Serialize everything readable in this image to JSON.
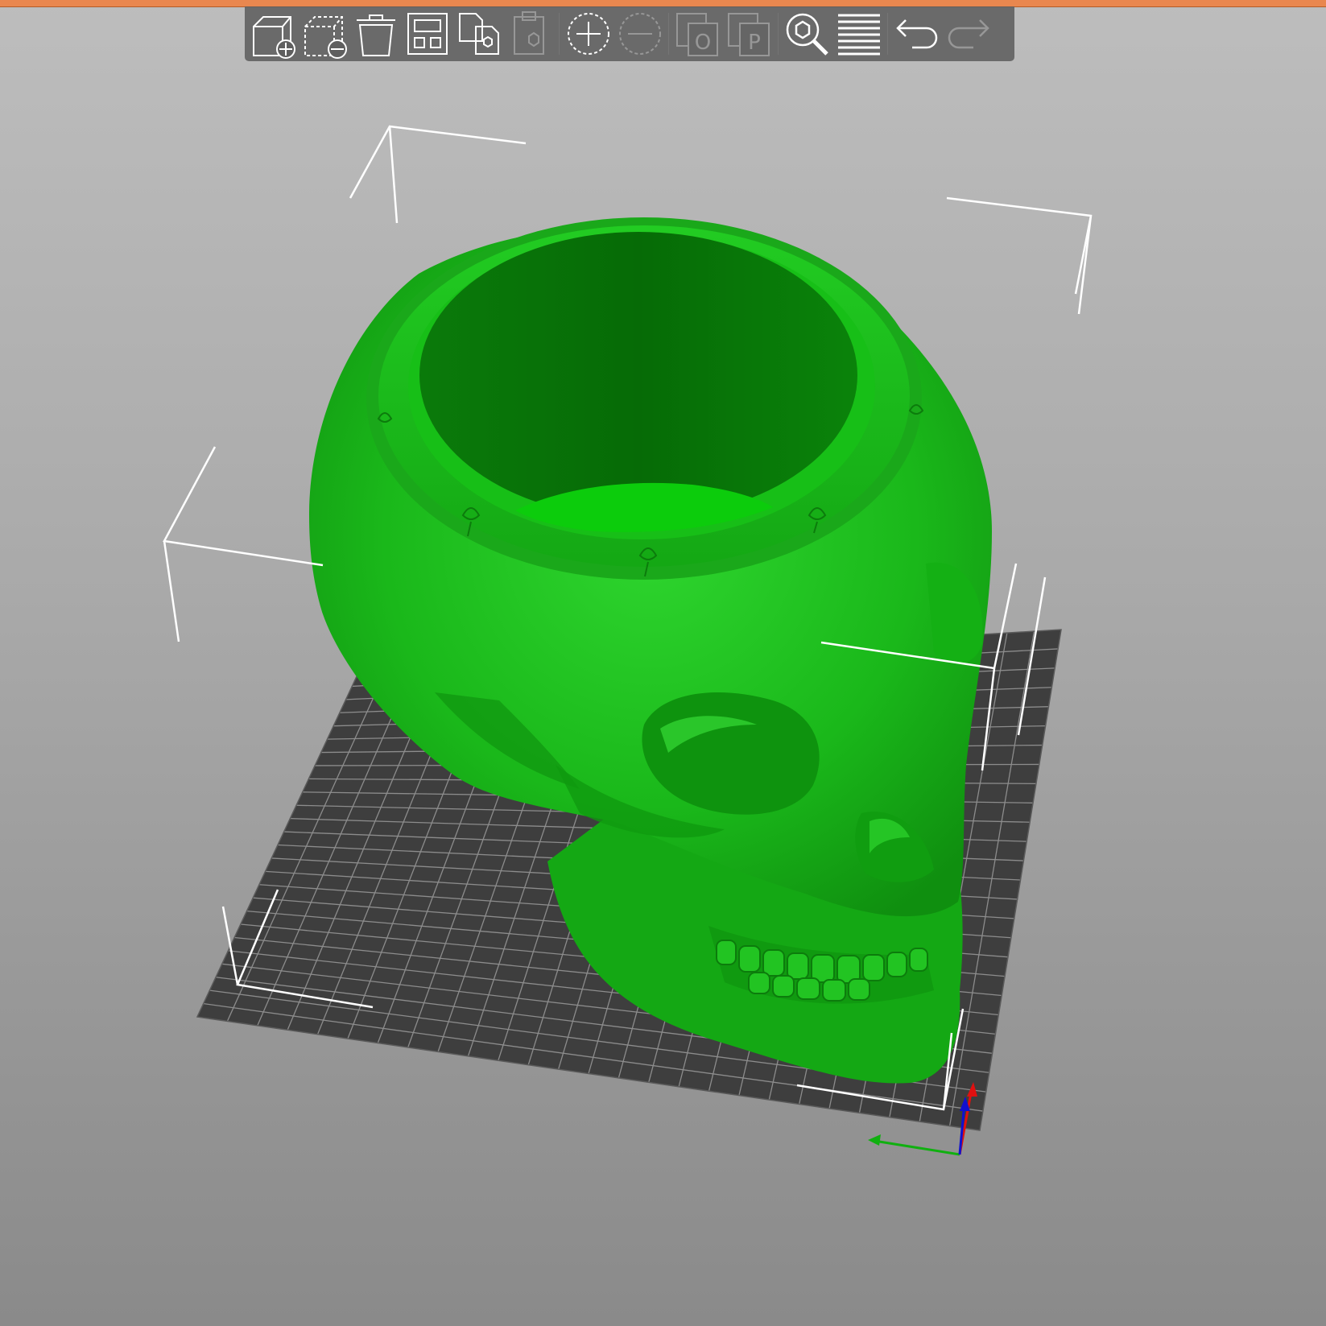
{
  "app": {
    "accent_color": "#e9874f"
  },
  "toolbar": {
    "buttons": [
      {
        "id": "add",
        "icon": "add-object-icon",
        "enabled": true
      },
      {
        "id": "delete",
        "icon": "delete-object-icon",
        "enabled": true
      },
      {
        "id": "delete-all",
        "icon": "trash-icon",
        "enabled": true
      },
      {
        "id": "arrange",
        "icon": "arrange-icon",
        "enabled": true
      },
      {
        "id": "copy",
        "icon": "copy-icon",
        "enabled": true
      },
      {
        "id": "paste",
        "icon": "paste-icon",
        "enabled": false
      },
      {
        "id": "instance-add",
        "icon": "add-instance-icon",
        "enabled": true
      },
      {
        "id": "instance-remove",
        "icon": "remove-instance-icon",
        "enabled": false
      },
      {
        "id": "split-objects",
        "icon": "split-objects-icon",
        "enabled": false
      },
      {
        "id": "split-parts",
        "icon": "split-parts-icon",
        "enabled": false
      },
      {
        "id": "search",
        "icon": "search-icon",
        "enabled": true
      },
      {
        "id": "layers",
        "icon": "layers-editing-icon",
        "enabled": true
      },
      {
        "id": "undo",
        "icon": "undo-icon",
        "enabled": true
      },
      {
        "id": "redo",
        "icon": "redo-icon",
        "enabled": false
      }
    ],
    "split_objects_letter": "O",
    "split_parts_letter": "P"
  },
  "scene": {
    "model": "skull-planter",
    "model_color": "#19c619",
    "bed_color": "#3e3e3e",
    "bed_grid_color": "#8c8c8c",
    "bounding_box_color": "#ffffff",
    "axes": {
      "x_color": "#e01010",
      "y_color": "#10b010",
      "z_color": "#1010d0"
    }
  }
}
